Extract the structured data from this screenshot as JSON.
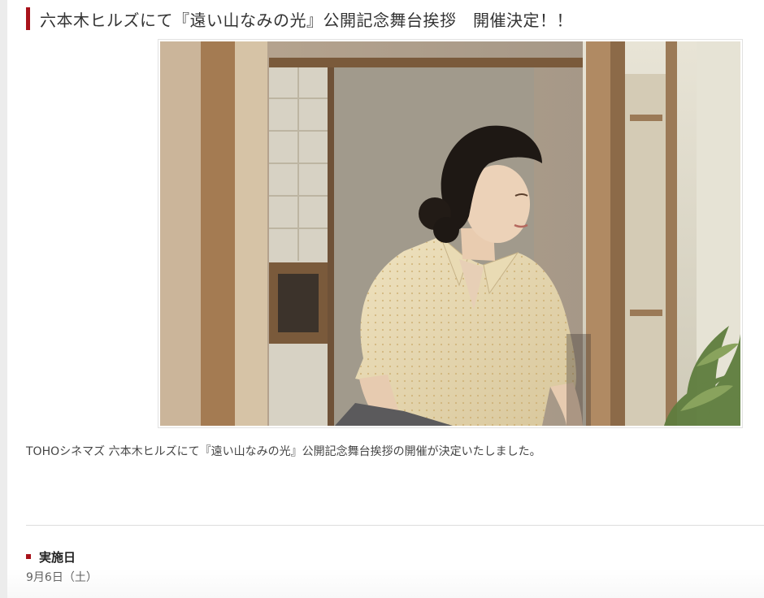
{
  "article": {
    "title": "六本木ヒルズにて『遠い山なみの光』公開記念舞台挨拶　開催決定！！",
    "lead": "TOHOシネマズ 六本木ヒルズにて『遠い山なみの光』公開記念舞台挨拶の開催が決定いたしました。",
    "photo_icon": "event-photo"
  },
  "event_date": {
    "label": "実施日",
    "value": "9月6日（土）"
  },
  "colors": {
    "accent": "#a8121a",
    "text": "#333333",
    "divider": "#dcdcdc"
  }
}
